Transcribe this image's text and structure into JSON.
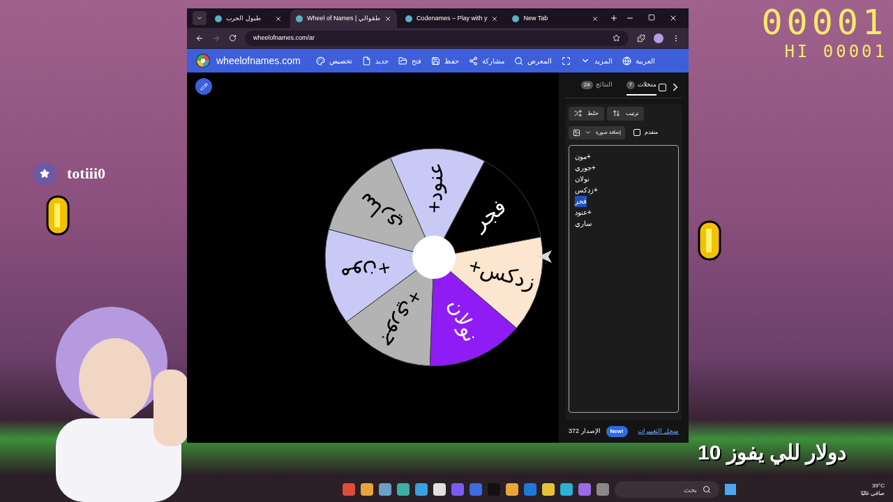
{
  "stream_overlay": {
    "score": "00001",
    "high_score": "HI 00001",
    "streamer_name": "totiii0",
    "prize_text": "دولار للي يفوز 10"
  },
  "browser": {
    "tabs": [
      {
        "title": "New Tab",
        "selected": false
      },
      {
        "title": "Codenames – Play with y",
        "selected": false
      },
      {
        "title": "Wheel of Names | طقوالي",
        "selected": true
      },
      {
        "title": "طبول الحرب",
        "selected": false
      }
    ],
    "address": "wheelofnames.com/ar"
  },
  "app": {
    "logo_text": "wheelofnames.com",
    "nav": [
      {
        "kind": "globe",
        "label": "العربية"
      },
      {
        "kind": "caret",
        "label": "المزيد"
      },
      {
        "kind": "fullscreen"
      },
      {
        "kind": "search",
        "label": "المعرض"
      },
      {
        "kind": "share",
        "label": "مشاركة"
      },
      {
        "kind": "save",
        "label": "حفظ"
      },
      {
        "kind": "folder",
        "label": "فتح"
      },
      {
        "kind": "file",
        "label": "جديد"
      },
      {
        "kind": "palette",
        "label": "تخصيص"
      }
    ],
    "wheel": {
      "segments": [
        {
          "label": "+مون",
          "color": "#c9c9f6"
        },
        {
          "label": "+جوري",
          "color": "#b3b3b3"
        },
        {
          "label": "نولان",
          "color": "#8f1cf5"
        },
        {
          "label": "+زدكس",
          "color": "#fde6cf"
        },
        {
          "label": "فجر",
          "color": "#000000"
        },
        {
          "label": "+عنود",
          "color": "#c9c9f6"
        },
        {
          "label": "ساري",
          "color": "#b3b3b3"
        }
      ]
    },
    "panel": {
      "tabs": [
        {
          "label": "منخلات",
          "count": "7",
          "selected": true
        },
        {
          "label": "النتائج",
          "count": "24",
          "selected": false
        }
      ],
      "hide_checked": false,
      "buttons": [
        {
          "kind": "sort",
          "label": "ترتيب"
        },
        {
          "kind": "shuffle",
          "label": "خلط"
        }
      ],
      "image_button": "إضافة صورة",
      "advanced": {
        "label": "متقدم",
        "checked": false
      },
      "entries": [
        {
          "text": "+مون",
          "selected": false
        },
        {
          "text": "+جوري",
          "selected": false
        },
        {
          "text": "نولان",
          "selected": false
        },
        {
          "text": "+زدكس",
          "selected": false
        },
        {
          "text": "فجر",
          "selected": true
        },
        {
          "text": "+عنود",
          "selected": false
        },
        {
          "text": "ساري",
          "selected": false
        }
      ],
      "version": "الإصدار 372",
      "new_badge": "New!",
      "changelog": "سجل التغييرات"
    }
  },
  "taskbar": {
    "search_placeholder": "بحث",
    "temperature": "39°C",
    "weather": "صافي غالبًا"
  }
}
